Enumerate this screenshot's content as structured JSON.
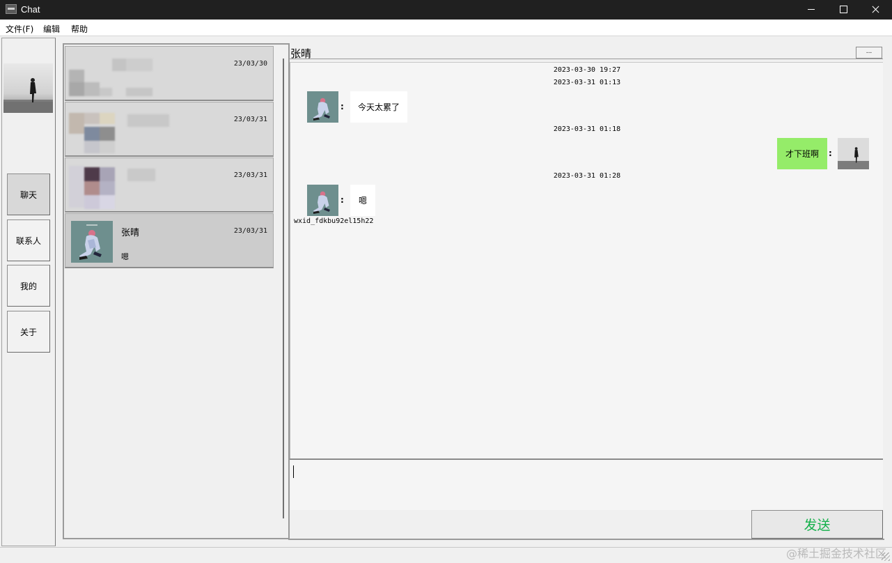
{
  "window": {
    "title": "Chat"
  },
  "menu": {
    "file": "文件(F)",
    "edit": "编辑",
    "help": "帮助"
  },
  "nav": {
    "chat": "聊天",
    "contacts": "联系人",
    "mine": "我的",
    "about": "关于",
    "active": "chat"
  },
  "conversations": [
    {
      "name": "",
      "date": "23/03/30",
      "last": "",
      "blurred": true
    },
    {
      "name": "",
      "date": "23/03/31",
      "last": "",
      "blurred": true
    },
    {
      "name": "",
      "date": "23/03/31",
      "last": "",
      "blurred": true
    },
    {
      "name": "张晴",
      "date": "23/03/31",
      "last": "嗯",
      "blurred": false,
      "selected": true
    }
  ],
  "chat": {
    "title": "张晴",
    "more_label": "...",
    "messages": [
      {
        "type": "time",
        "text": "2023-03-30 19:27"
      },
      {
        "type": "time",
        "text": "2023-03-31 01:13"
      },
      {
        "type": "msg",
        "from": "other",
        "text": "今天太累了"
      },
      {
        "type": "time",
        "text": "2023-03-31 01:18"
      },
      {
        "type": "msg",
        "from": "self",
        "text": "才下班啊"
      },
      {
        "type": "time",
        "text": "2023-03-31 01:28"
      },
      {
        "type": "msg",
        "from": "other",
        "text": "嗯",
        "sender_id": "wxid_fdkbu92el15h22"
      }
    ],
    "input_value": "",
    "send_label": "发送"
  },
  "watermark": "@稀土掘金技术社区",
  "colors": {
    "self_bubble": "#95ec69",
    "send_text": "#14b04a",
    "title_bar": "#202020"
  }
}
